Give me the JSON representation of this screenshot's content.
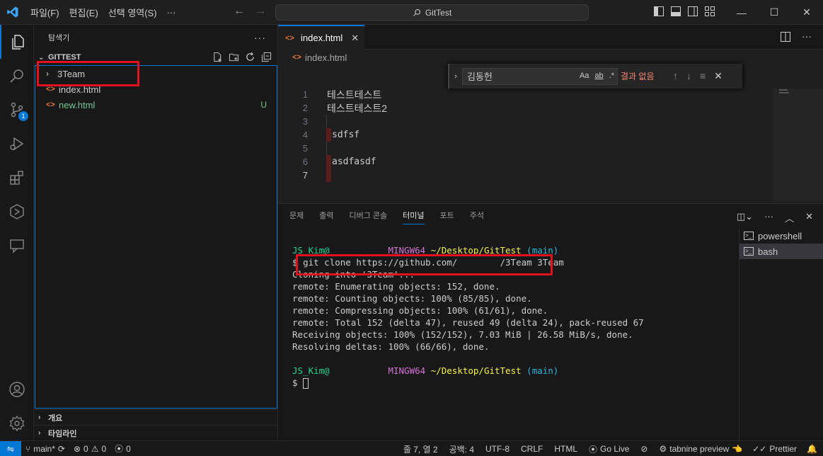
{
  "titlebar": {
    "menu": [
      "파일(F)",
      "편집(E)",
      "선택 영역(S)",
      "···"
    ],
    "search": "GitTest"
  },
  "activity": {
    "scm_badge": "1"
  },
  "sidebar": {
    "title": "탐색기",
    "root": "GITTEST",
    "items": [
      {
        "label": "3Team",
        "kind": "folder"
      },
      {
        "label": "index.html",
        "kind": "file"
      },
      {
        "label": "new.html",
        "kind": "file",
        "status": "U"
      }
    ],
    "outline": "개요",
    "timeline": "타임라인"
  },
  "editor": {
    "tab_label": "index.html",
    "breadcrumb": "index.html",
    "lines": [
      {
        "n": "1",
        "text": "테스트테스트"
      },
      {
        "n": "2",
        "text": "테스트테스트2"
      },
      {
        "n": "3",
        "text": ""
      },
      {
        "n": "4",
        "text": "sdfsf"
      },
      {
        "n": "5",
        "text": ""
      },
      {
        "n": "6",
        "text": "asdfasdf"
      },
      {
        "n": "7",
        "text": ""
      }
    ]
  },
  "find": {
    "query": "김동헌",
    "opt_case": "Aa",
    "opt_word": "ab",
    "opt_regex": ".*",
    "result": "결과 없음"
  },
  "panel": {
    "tabs": [
      "문제",
      "출력",
      "디버그 콘솔",
      "터미널",
      "포트",
      "주석"
    ],
    "active_tab": "터미널",
    "terminal": {
      "user": "JS_Kim@",
      "host": "MINGW64",
      "path": "~/Desktop/GitTest",
      "branch": "(main)",
      "command": "git clone https://github.com/        /3Team 3Team",
      "output": [
        "Cloning into '3Team'...",
        "remote: Enumerating objects: 152, done.",
        "remote: Counting objects: 100% (85/85), done.",
        "remote: Compressing objects: 100% (61/61), done.",
        "remote: Total 152 (delta 47), reused 49 (delta 24), pack-reused 67",
        "Receiving objects: 100% (152/152), 7.03 MiB | 26.58 MiB/s, done.",
        "Resolving deltas: 100% (66/66), done."
      ]
    },
    "terminals": [
      "powershell",
      "bash"
    ]
  },
  "statusbar": {
    "branch": "main*",
    "errors": "0",
    "warnings": "0",
    "ports": "0",
    "position": "줄 7, 열 2",
    "spaces": "공백: 4",
    "encoding": "UTF-8",
    "eol": "CRLF",
    "language": "HTML",
    "golive": "Go Live",
    "tabnine": "tabnine preview",
    "prettier": "Prettier"
  }
}
